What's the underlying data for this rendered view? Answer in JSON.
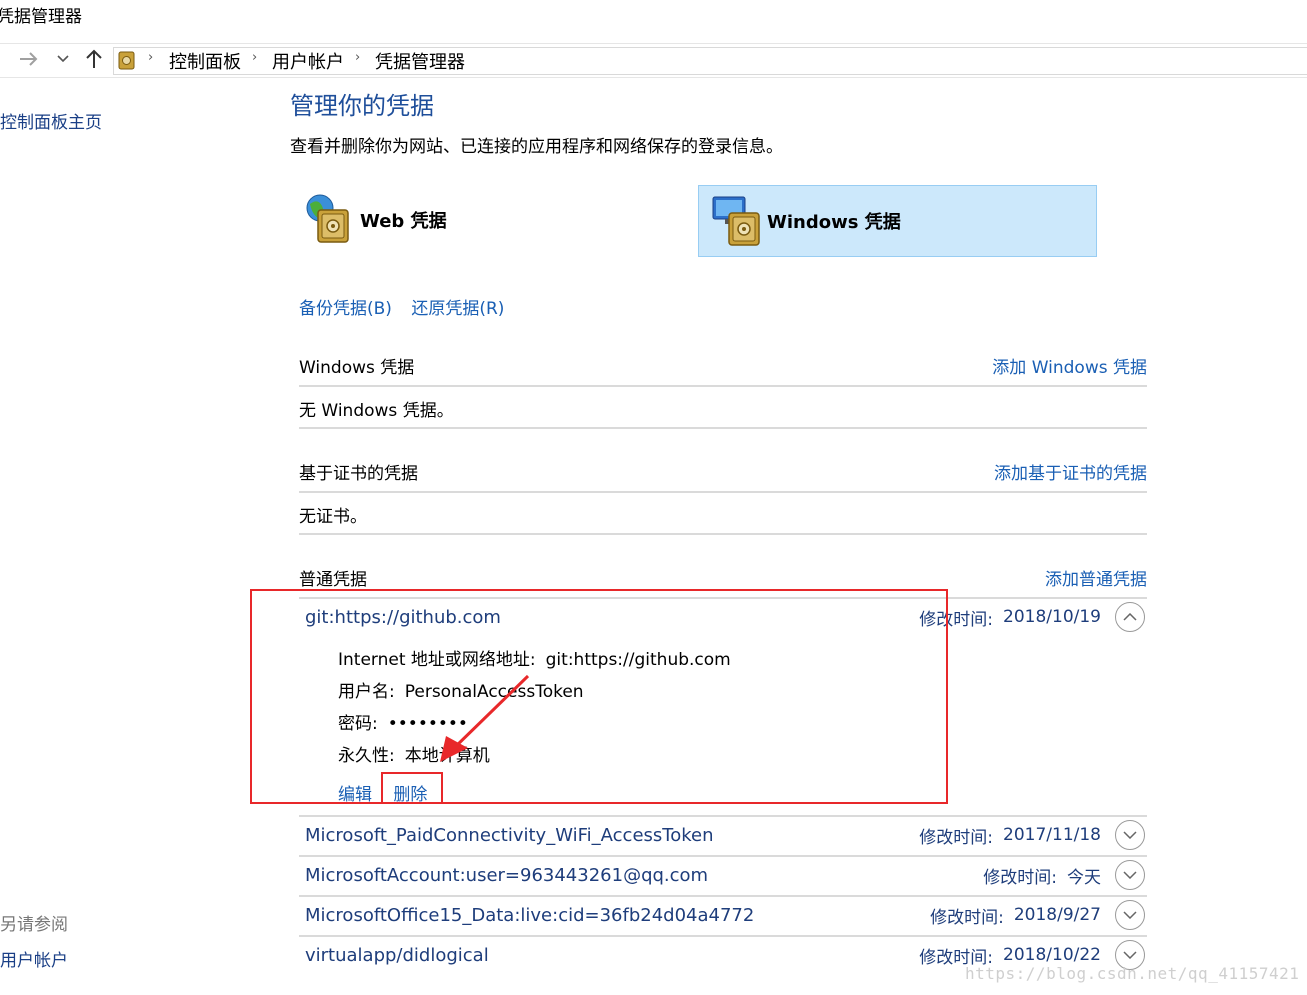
{
  "window": {
    "title": "凭据管理器"
  },
  "addressbar": {
    "breadcrumbs": [
      "控制面板",
      "用户帐户",
      "凭据管理器"
    ]
  },
  "sidebar": {
    "home_link": "控制面板主页",
    "see_also_label": "另请参阅",
    "see_also_link": "用户帐户"
  },
  "main": {
    "title": "管理你的凭据",
    "description": "查看并删除你为网站、已连接的应用程序和网络保存的登录信息。",
    "types": [
      {
        "label": "Web 凭据",
        "selected": false
      },
      {
        "label": "Windows 凭据",
        "selected": true
      }
    ],
    "backup_link": "备份凭据(B)",
    "restore_link": "还原凭据(R)",
    "windows_section": {
      "title": "Windows 凭据",
      "add_link": "添加 Windows 凭据",
      "empty_text": "无 Windows 凭据。"
    },
    "cert_section": {
      "title": "基于证书的凭据",
      "add_link": "添加基于证书的凭据",
      "empty_text": "无证书。"
    },
    "generic_section": {
      "title": "普通凭据",
      "add_link": "添加普通凭据",
      "expanded": {
        "name": "git:https://github.com",
        "modified_label": "修改时间:",
        "modified_value": "2018/10/19",
        "fields": [
          {
            "key": "Internet 地址或网络地址:",
            "value": "git:https://github.com"
          },
          {
            "key": "用户名:",
            "value": "PersonalAccessToken"
          },
          {
            "key": "密码:",
            "value": "••••••••"
          },
          {
            "key": "永久性:",
            "value": "本地计算机"
          }
        ],
        "edit_link": "编辑",
        "delete_link": "删除"
      },
      "items": [
        {
          "name": "Microsoft_PaidConnectivity_WiFi_AccessToken",
          "modified_label": "修改时间:",
          "modified_value": "2017/11/18"
        },
        {
          "name": "MicrosoftAccount:user=963443261@qq.com",
          "modified_label": "修改时间:",
          "modified_value": "今天"
        },
        {
          "name": "MicrosoftOffice15_Data:live:cid=36fb24d04a4772",
          "modified_label": "修改时间:",
          "modified_value": "2018/9/27"
        },
        {
          "name": "virtualapp/didlogical",
          "modified_label": "修改时间:",
          "modified_value": "2018/10/22"
        }
      ]
    }
  },
  "watermark": "https://blog.csdn.net/qq_41157421",
  "colors": {
    "link": "#1a5fb4",
    "title": "#1e4e9a",
    "selected_tile": "#cce8fb",
    "highlight": "#e8282a"
  }
}
